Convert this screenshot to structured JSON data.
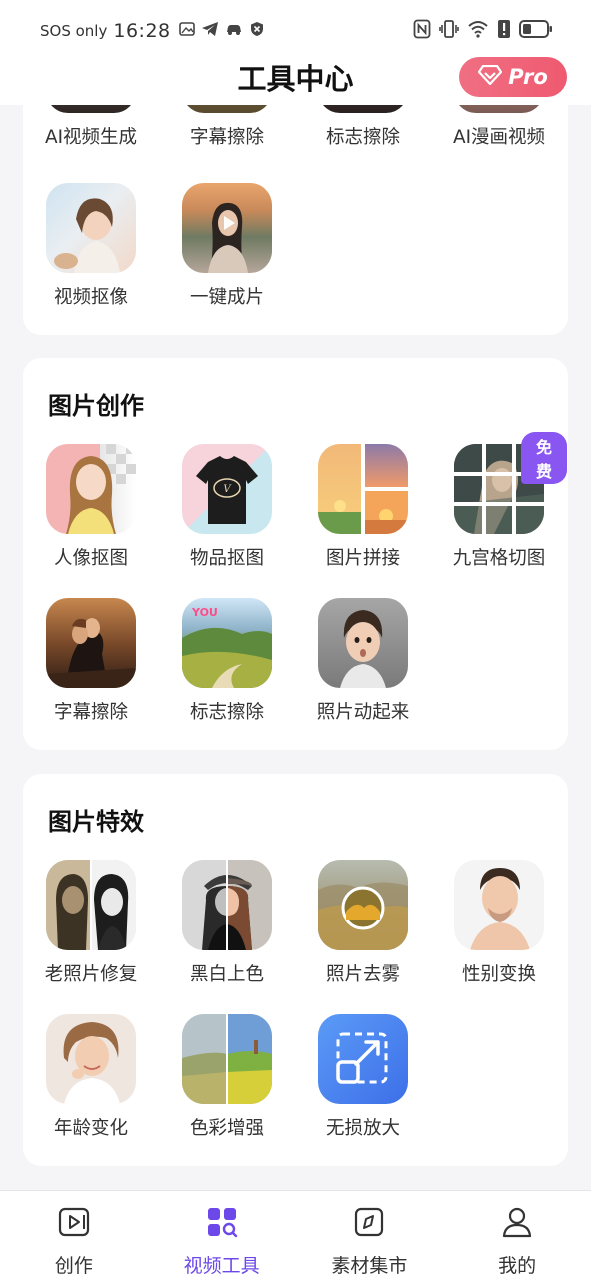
{
  "status_bar": {
    "carrier": "SOS only",
    "time": "16:28"
  },
  "header": {
    "title": "工具中心",
    "pro_label": "Pro"
  },
  "video_section": {
    "partial_items": [
      {
        "label": "AI视频生成",
        "thumb": "ai-video-thumb"
      },
      {
        "label": "字幕擦除",
        "thumb": "subtitle-erase-thumb"
      },
      {
        "label": "标志擦除",
        "thumb": "logo-erase-thumb"
      },
      {
        "label": "AI漫画视频",
        "thumb": "ai-comic-thumb"
      }
    ],
    "items": [
      {
        "label": "视频抠像",
        "thumb": "video-matting-thumb"
      },
      {
        "label": "一键成片",
        "thumb": "one-click-video-thumb"
      }
    ]
  },
  "picture_creation": {
    "title": "图片创作",
    "items": [
      {
        "label": "人像抠图",
        "thumb": "portrait-cutout-thumb"
      },
      {
        "label": "物品抠图",
        "thumb": "object-cutout-thumb"
      },
      {
        "label": "图片拼接",
        "thumb": "image-stitch-thumb"
      },
      {
        "label": "九宫格切图",
        "thumb": "nine-grid-thumb",
        "badge": "免费"
      },
      {
        "label": "字幕擦除",
        "thumb": "subtitle-erase-thumb"
      },
      {
        "label": "标志擦除",
        "thumb": "logo-erase-thumb"
      },
      {
        "label": "照片动起来",
        "thumb": "animate-photo-thumb"
      }
    ]
  },
  "picture_effects": {
    "title": "图片特效",
    "items": [
      {
        "label": "老照片修复",
        "thumb": "old-photo-restore-thumb"
      },
      {
        "label": "黑白上色",
        "thumb": "colorize-thumb"
      },
      {
        "label": "照片去雾",
        "thumb": "dehaze-thumb"
      },
      {
        "label": "性别变换",
        "thumb": "gender-swap-thumb"
      },
      {
        "label": "年龄变化",
        "thumb": "age-change-thumb"
      },
      {
        "label": "色彩增强",
        "thumb": "color-enhance-thumb"
      },
      {
        "label": "无损放大",
        "thumb": "lossless-upscale-icon"
      }
    ]
  },
  "bottom_nav": [
    {
      "label": "创作",
      "icon": "create-icon"
    },
    {
      "label": "视频工具",
      "icon": "video-tools-icon",
      "active": true
    },
    {
      "label": "素材集市",
      "icon": "material-market-icon"
    },
    {
      "label": "我的",
      "icon": "profile-icon"
    }
  ],
  "colors": {
    "accent": "#6c48e8",
    "pro": "#ef5a70",
    "badge": "#8a56f2",
    "background": "#f5f5f7"
  }
}
